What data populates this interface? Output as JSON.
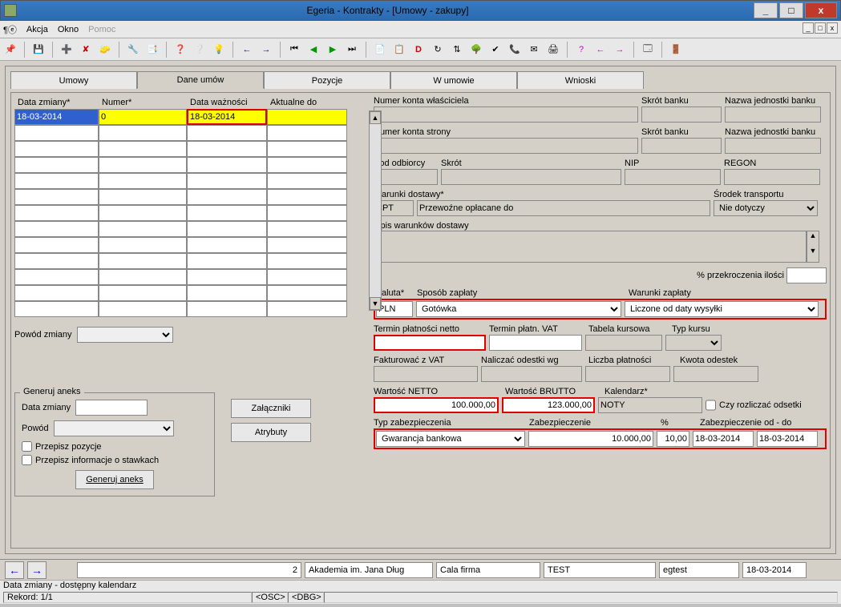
{
  "window": {
    "title": "Egeria - Kontrakty - [Umowy - zakupy]",
    "min": "_",
    "max": "□",
    "close": "x"
  },
  "menu": {
    "akcja": "Akcja",
    "okno": "Okno",
    "pomoc": "Pomoc"
  },
  "tabs": {
    "umowy": "Umowy",
    "dane": "Dane umów",
    "pozycje": "Pozycje",
    "wumowie": "W umowie",
    "wnioski": "Wnioski"
  },
  "grid": {
    "h1": "Data zmiany*",
    "h2": "Numer*",
    "h3": "Data ważności",
    "h4": "Aktualne do",
    "row0": {
      "c1": "18-03-2014",
      "c2": "0",
      "c3": "18-03-2014",
      "c4": ""
    }
  },
  "powod_zmiany_lbl": "Powód zmiany",
  "aneks": {
    "legend": "Generuj aneks",
    "data_zmiany_lbl": "Data zmiany",
    "powod_lbl": "Powód",
    "przepisz_pozycje": "Przepisz pozycje",
    "przepisz_stawki": "Przepisz informacje o stawkach",
    "generuj_btn": "Generuj aneks",
    "zalaczniki_btn": "Załączniki",
    "atrybuty_btn": "Atrybuty"
  },
  "right": {
    "numer_konta_wl": "Numer konta właściciela",
    "skrot_banku": "Skrót banku",
    "nazwa_jednostki": "Nazwa jednostki banku",
    "numer_konta_str": "Numer konta strony",
    "kod_odbiorcy": "Kod odbiorcy",
    "skrot": "Skrót",
    "nip": "NIP",
    "regon": "REGON",
    "warunki_dostawy": "Warunki dostawy*",
    "srodek_transportu": "Środek transportu",
    "warunki_dostawy_val": "CPT",
    "warunki_dostawy_desc": "Przewoźne opłacane do",
    "srodek_val": "Nie dotyczy",
    "opis_warunkow": "Opis warunków dostawy",
    "pct_przekroczenia": "% przekroczenia ilości",
    "waluta": "Waluta*",
    "sposob_zaplaty": "Sposób zapłaty",
    "warunki_zaplaty": "Warunki zapłaty",
    "waluta_val": "PLN",
    "sposob_val": "Gotówka",
    "warunki_val": "Liczone od daty wysyłki",
    "termin_netto": "Termin płatności netto",
    "termin_vat": "Termin płatn. VAT",
    "tabela_kursowa": "Tabela kursowa",
    "typ_kursu": "Typ kursu",
    "fakturowac": "Fakturować z VAT",
    "naliczac_odsetki": "Naliczać odestki wg",
    "liczba_platnosci": "Liczba płatności",
    "kwota_odestek": "Kwota odestek",
    "wartosc_netto": "Wartość NETTO",
    "wartosc_brutto": "Wartość BRUTTO",
    "kalendarz": "Kalendarz*",
    "czy_rozliczac": "Czy rozliczać odsetki",
    "netto_val": "100.000,00",
    "brutto_val": "123.000,00",
    "kalendarz_val": "NOTY",
    "typ_zabezp": "Typ zabezpieczenia",
    "zabezpieczenie": "Zabezpieczenie",
    "pct": "%",
    "zabezp_od_do": "Zabezpieczenie od - do",
    "typ_zabezp_val": "Gwarancja bankowa",
    "zabezp_val": "10.000,00",
    "pct_val": "10,00",
    "zabezp_od": "18-03-2014",
    "zabezp_do": "18-03-2014"
  },
  "status": {
    "num": "2",
    "akademia": "Akademia im. Jana Dług",
    "cala_firma": "Cala firma",
    "test": "TEST",
    "egtest": "egtest",
    "date": "18-03-2014"
  },
  "footer": {
    "line1": "Data zmiany - dostępny kalendarz",
    "rekord": "Rekord: 1/1",
    "osc": "<OSC>",
    "dbg": "<DBG>"
  }
}
